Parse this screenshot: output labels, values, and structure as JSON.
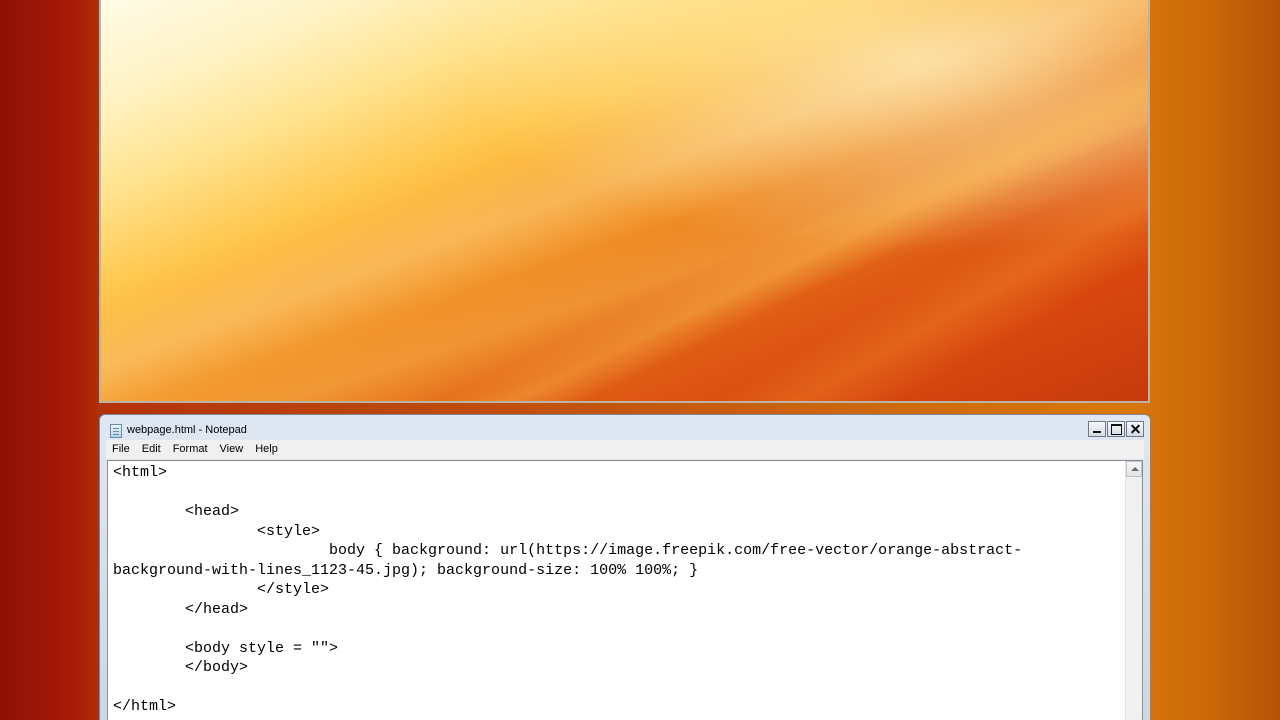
{
  "browser": {
    "viewport_description_label": ""
  },
  "notepad": {
    "title": "webpage.html - Notepad",
    "icon": "notepad-icon",
    "caption_buttons": {
      "minimize": "minimize-icon",
      "maximize": "maximize-icon",
      "close": "close-icon"
    },
    "menu": [
      "File",
      "Edit",
      "Format",
      "View",
      "Help"
    ],
    "lines": [
      "<html>",
      "",
      "        <head>",
      "                <style>",
      "                        body { background: url(https://image.freepik.com/free-vector/orange-abstract-",
      "background-with-lines_1123-45.jpg); background-size: 100% 100%; }",
      "                </style>",
      "        </head>",
      "",
      "        <body style = \"\">",
      "        </body>",
      "",
      "</html>"
    ]
  },
  "colors": {
    "desktop_left": "#8e0f05",
    "desktop_right": "#d8780a",
    "notepad_frame": "#cbd6e6",
    "editor_bg": "#ffffff"
  }
}
